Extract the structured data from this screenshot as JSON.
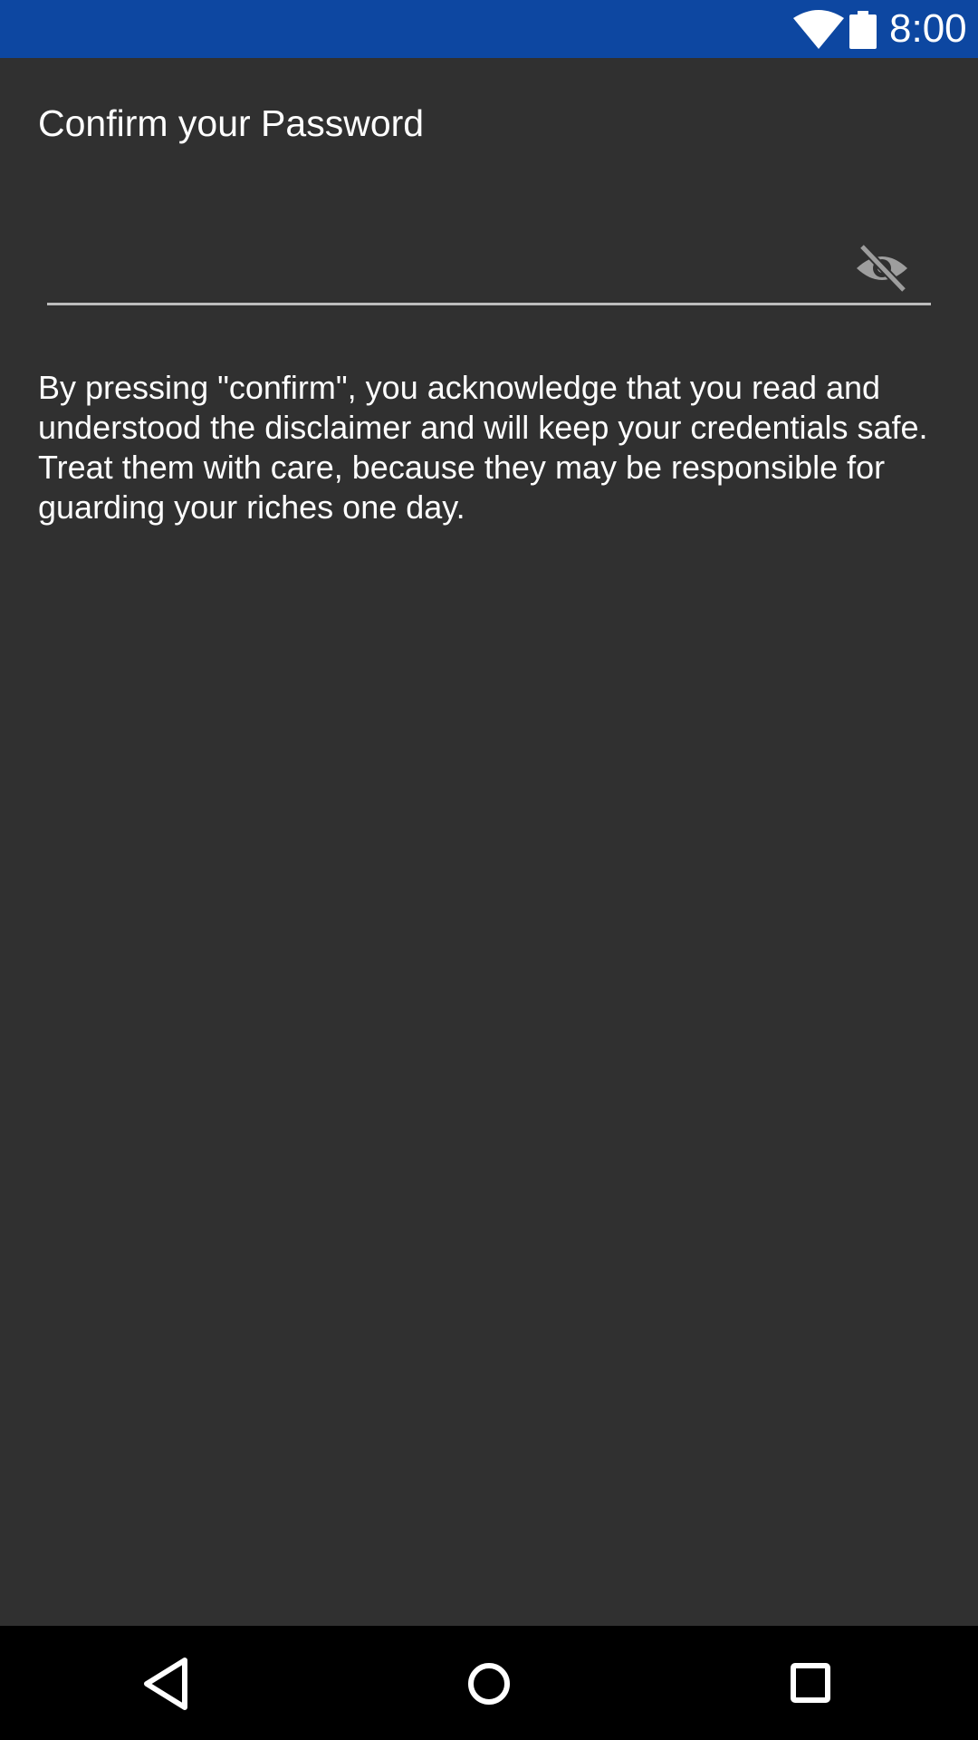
{
  "status_bar": {
    "time": "8:00",
    "icons": [
      "wifi-icon",
      "battery-icon"
    ],
    "background": "#0d47a1"
  },
  "page": {
    "title": "Confirm your Password",
    "background": "#303030"
  },
  "password_field": {
    "value": "",
    "placeholder": "",
    "toggle_icon": "visibility-off-icon"
  },
  "disclaimer": {
    "text": "By pressing \"confirm\", you acknowledge that you read and understood the disclaimer and will keep your credentials safe. Treat them with care, because they may be responsible for guarding your riches one day."
  },
  "nav_bar": {
    "buttons": [
      "back-icon",
      "home-icon",
      "recents-icon"
    ]
  }
}
